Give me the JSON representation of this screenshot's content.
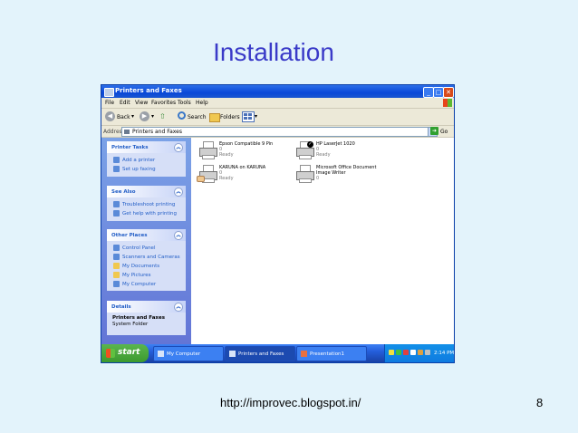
{
  "slide": {
    "title": "Installation",
    "footer_url": "http://improvec.blogspot.in/",
    "page_number": "8"
  },
  "window": {
    "title": "Printers and Faxes",
    "controls": {
      "minimize": "_",
      "maximize": "□",
      "close": "✕"
    },
    "menu": [
      "File",
      "Edit",
      "View",
      "Favorites",
      "Tools",
      "Help"
    ],
    "toolbar": {
      "back": "Back",
      "search": "Search",
      "folders": "Folders"
    },
    "address": {
      "label": "Address",
      "value": "Printers and Faxes",
      "go": "Go"
    }
  },
  "taskpane": {
    "printer_tasks": {
      "title": "Printer Tasks",
      "items": [
        "Add a printer",
        "Set up faxing"
      ]
    },
    "see_also": {
      "title": "See Also",
      "items": [
        "Troubleshoot printing",
        "Get help with printing"
      ]
    },
    "other_places": {
      "title": "Other Places",
      "items": [
        "Control Panel",
        "Scanners and Cameras",
        "My Documents",
        "My Pictures",
        "My Computer"
      ]
    },
    "details": {
      "title": "Details",
      "name": "Printers and Faxes",
      "subtitle": "System Folder"
    }
  },
  "printers": [
    {
      "name": "Epson Compatible 9 Pin",
      "docs": "0",
      "status": "Ready",
      "default": false
    },
    {
      "name": "HP LaserJet 1020",
      "docs": "0",
      "status": "Ready",
      "default": true
    },
    {
      "name": "KARUNA on KARUNA",
      "docs": "0",
      "status": "Ready",
      "default": false
    },
    {
      "name": "Microsoft Office Document",
      "name2": "Image Writer",
      "docs": "0",
      "default": false
    }
  ],
  "taskbar": {
    "start": "start",
    "tasks": [
      "My Computer",
      "Printers and Faxes",
      "Presentation1"
    ],
    "clock": "2:14 PM"
  },
  "colors": {
    "accent": "#3a3ac8",
    "xp_blue": "#0a48d8",
    "panel_link": "#215dc6",
    "start_green": "#3c9a2e"
  }
}
